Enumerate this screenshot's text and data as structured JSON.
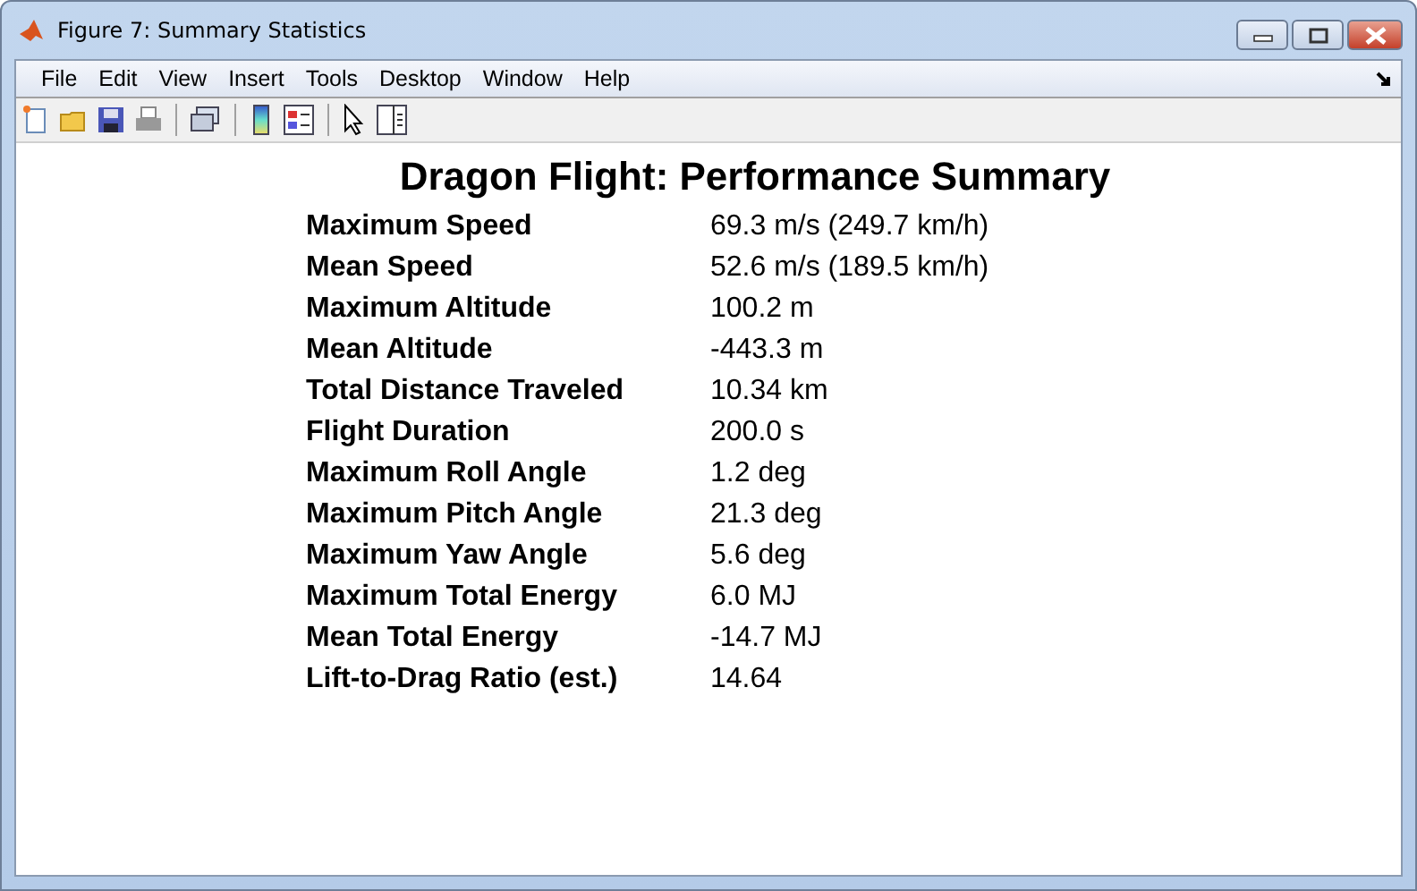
{
  "window": {
    "title": "Figure 7: Summary Statistics"
  },
  "menu": [
    "File",
    "Edit",
    "View",
    "Insert",
    "Tools",
    "Desktop",
    "Window",
    "Help"
  ],
  "figure": {
    "title": "Dragon Flight: Performance Summary",
    "rows": [
      {
        "label": "Maximum Speed",
        "value": "69.3 m/s (249.7 km/h)"
      },
      {
        "label": "Mean Speed",
        "value": "52.6 m/s (189.5 km/h)"
      },
      {
        "label": "Maximum Altitude",
        "value": "100.2 m"
      },
      {
        "label": "Mean Altitude",
        "value": "-443.3 m"
      },
      {
        "label": "Total Distance Traveled",
        "value": "10.34 km"
      },
      {
        "label": "Flight Duration",
        "value": "200.0 s"
      },
      {
        "label": "Maximum Roll Angle",
        "value": "1.2 deg"
      },
      {
        "label": "Maximum Pitch Angle",
        "value": "21.3 deg"
      },
      {
        "label": "Maximum Yaw Angle",
        "value": "5.6 deg"
      },
      {
        "label": "Maximum Total Energy",
        "value": "6.0 MJ"
      },
      {
        "label": "Mean Total Energy",
        "value": "-14.7 MJ"
      },
      {
        "label": "Lift-to-Drag Ratio (est.)",
        "value": "14.64"
      }
    ]
  }
}
